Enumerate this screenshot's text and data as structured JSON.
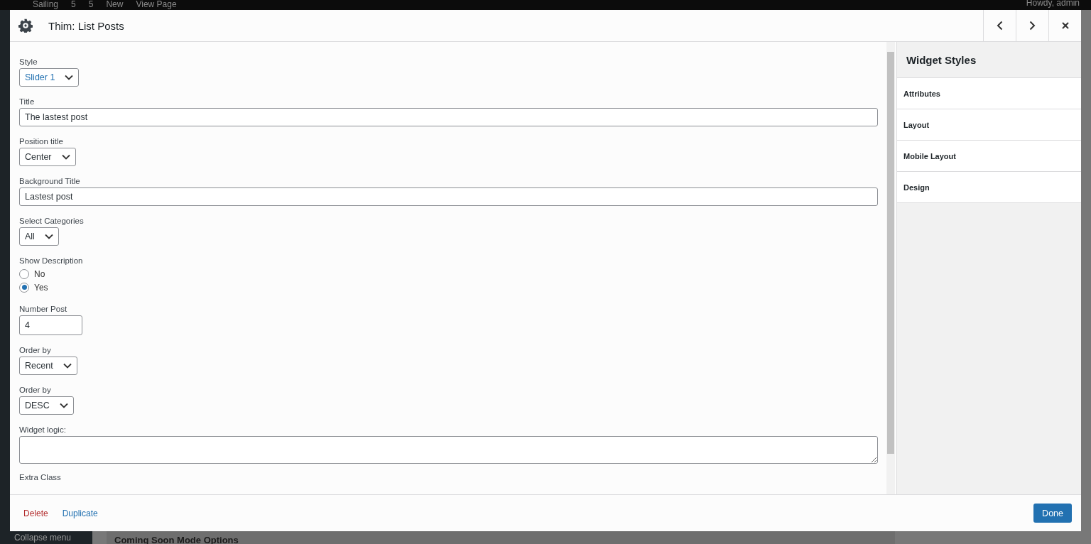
{
  "admin_bar": {
    "items": [
      "Sailing",
      "5",
      "5",
      "New",
      "View Page"
    ],
    "account": "Howdy, admin"
  },
  "admin_menu": {
    "collapse": "Collapse menu"
  },
  "background_panel": {
    "title": "Coming Soon Mode Options"
  },
  "dialog": {
    "title": "Thim: List Posts",
    "fields": [
      {
        "kind": "select",
        "label": "Style",
        "value": "Slider 1",
        "accent": true
      },
      {
        "kind": "text",
        "label": "Title",
        "value": "The lastest post"
      },
      {
        "kind": "select",
        "label": "Position title",
        "value": "Center",
        "accent": false
      },
      {
        "kind": "text",
        "label": "Background Title",
        "value": "Lastest post"
      },
      {
        "kind": "select",
        "label": "Select Categories",
        "value": "All",
        "accent": false
      },
      {
        "kind": "radio",
        "label": "Show Description",
        "options": [
          {
            "label": "No",
            "selected": false
          },
          {
            "label": "Yes",
            "selected": true
          }
        ]
      },
      {
        "kind": "number",
        "label": "Number Post",
        "value": "4"
      },
      {
        "kind": "select",
        "label": "Order by",
        "value": "Recent",
        "accent": false
      },
      {
        "kind": "select",
        "label": "Order by",
        "value": "DESC",
        "accent": false
      },
      {
        "kind": "textarea",
        "label": "Widget logic:"
      },
      {
        "kind": "cut",
        "label": "Extra Class"
      }
    ],
    "side_panel": {
      "title": "Widget Styles",
      "sections": [
        "Attributes",
        "Layout",
        "Mobile Layout",
        "Design"
      ]
    },
    "footer": {
      "delete": "Delete",
      "duplicate": "Duplicate",
      "done": "Done"
    }
  }
}
